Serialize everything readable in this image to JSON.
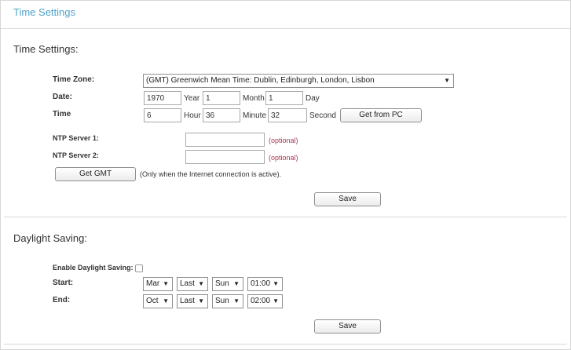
{
  "header": {
    "title": "Time Settings"
  },
  "time_section": {
    "title": "Time Settings:",
    "time_zone": {
      "label": "Time Zone:",
      "value": "(GMT) Greenwich Mean Time: Dublin, Edinburgh, London, Lisbon",
      "chev": "▼"
    },
    "date": {
      "label": "Date:",
      "year": "1970",
      "year_unit": "Year",
      "month": "1",
      "month_unit": "Month",
      "day": "1",
      "day_unit": "Day"
    },
    "time": {
      "label": "Time",
      "hour": "6",
      "hour_unit": "Hour",
      "minute": "36",
      "minute_unit": "Minute",
      "second": "32",
      "second_unit": "Second",
      "get_from_pc": "Get from PC"
    },
    "ntp1": {
      "label": "NTP Server 1:",
      "value": "",
      "optional": "(optional)"
    },
    "ntp2": {
      "label": "NTP Server 2:",
      "value": "",
      "optional": "(optional)"
    },
    "get_gmt": {
      "label": "Get GMT",
      "note": "(Only when the Internet connection is active)."
    },
    "save": "Save"
  },
  "dst_section": {
    "title": "Daylight Saving:",
    "enable_label": "Enable Daylight Saving:",
    "enabled": false,
    "start": {
      "label": "Start:",
      "month": "Mar",
      "week": "Last",
      "day": "Sun",
      "time": "01:00"
    },
    "end": {
      "label": "End:",
      "month": "Oct",
      "week": "Last",
      "day": "Sun",
      "time": "02:00"
    },
    "chev": "▼",
    "save": "Save"
  }
}
